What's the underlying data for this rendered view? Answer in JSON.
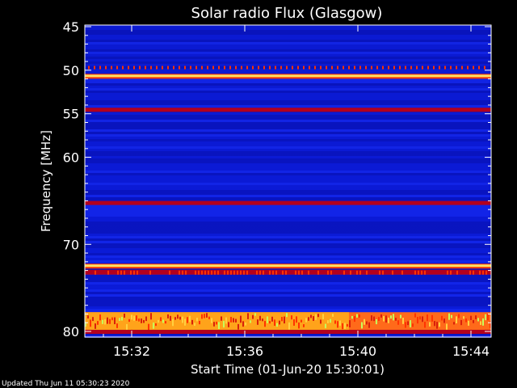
{
  "chart_data": {
    "type": "heatmap",
    "title": "Solar radio Flux (Glasgow)",
    "ylabel": "Frequency [MHz]",
    "xlabel": "Start Time (01-Jun-20 15:30:01)",
    "footer": "Updated Thu Jun 11 05:30:23 2020",
    "y_ticks": [
      45,
      50,
      55,
      60,
      70,
      80
    ],
    "x_ticks": [
      "15:32",
      "15:36",
      "15:40",
      "15:44"
    ],
    "bands": [
      {
        "freq": 49.7,
        "level": "dotted-red"
      },
      {
        "freq": 50.7,
        "level": "very-high"
      },
      {
        "freq": 54.5,
        "level": "medium"
      },
      {
        "freq": 65.2,
        "level": "medium"
      },
      {
        "freq": 72.5,
        "level": "very-high"
      },
      {
        "freq": 73.2,
        "level": "high"
      },
      {
        "freq": 79.0,
        "level": "high-noisy"
      },
      {
        "freq": 80.0,
        "level": "medium"
      }
    ],
    "colors": {
      "background": "#000000",
      "low": "#0a16c8",
      "mid": "#2a3dff",
      "medium": "#b3001e",
      "high": "#ff3300",
      "very-high": "#ffe066",
      "saturated": "#ffffaa"
    }
  }
}
